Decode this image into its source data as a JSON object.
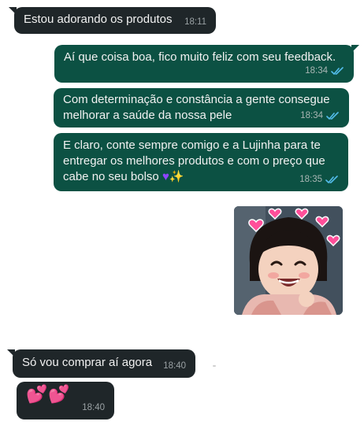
{
  "messages": [
    {
      "id": "m1",
      "direction": "incoming",
      "text": "Estou adorando os produtos",
      "time": "18:11"
    },
    {
      "id": "m2",
      "direction": "outgoing",
      "text": "Aí que coisa boa, fico muito feliz com seu feedback.",
      "time": "18:34",
      "status": "read"
    },
    {
      "id": "m3",
      "direction": "outgoing",
      "text": "Com determinação e constância a gente consegue melhorar a saúde da nossa pele",
      "time": "18:34",
      "status": "read"
    },
    {
      "id": "m4",
      "direction": "outgoing",
      "text": "E claro, conte sempre comigo e a Lujinha para te entregar os melhores produtos e com o preço que cabe no seu bolso",
      "emoji": [
        "purple-heart",
        "sparkles"
      ],
      "time": "18:35",
      "status": "read"
    },
    {
      "id": "m5",
      "direction": "outgoing",
      "type": "sticker",
      "sticker": "smiling-toddler-with-heart-hairclips"
    },
    {
      "id": "m6",
      "direction": "incoming",
      "text": "Só vou comprar aí agora",
      "time": "18:40"
    },
    {
      "id": "m7",
      "direction": "incoming",
      "type": "emoji",
      "emoji": [
        "two-hearts",
        "two-hearts"
      ],
      "time": "18:40"
    }
  ],
  "colors": {
    "incoming_bubble": "#1f2629",
    "outgoing_bubble": "#0c5143",
    "read_check": "#53bdeb",
    "background": "#ffffff"
  }
}
